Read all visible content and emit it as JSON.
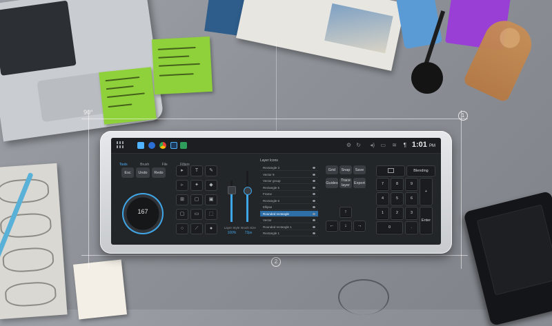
{
  "annotations": {
    "angle_label": "90°",
    "callout_1": "1",
    "callout_2": "2"
  },
  "taskbar": {
    "start_icon": "windows-icon",
    "pinned_icons": [
      "edge-icon",
      "chrome-icon",
      "photoshop-icon",
      "app-icon"
    ],
    "clock": "1:01",
    "clock_suffix": "PM"
  },
  "tabs": [
    {
      "label": "Tools",
      "active": true
    },
    {
      "label": "Brush",
      "active": false
    },
    {
      "label": "File",
      "active": false
    },
    {
      "label": "Filters",
      "active": false
    }
  ],
  "left_keys": {
    "esc": "Esc",
    "undo": "Undo",
    "redo": "Redo"
  },
  "dial": {
    "value": "167"
  },
  "tools": [
    "▸",
    "T",
    "✎",
    "▹",
    "✦",
    "◆",
    "⊞",
    "▢",
    "▣",
    "▢",
    "▭",
    "⬚",
    "○",
    "⟋",
    "●"
  ],
  "sliders": [
    {
      "caption": "Layer Style",
      "value": "100%",
      "level": 0.78
    },
    {
      "caption": "Brush Size",
      "value": "72px",
      "level": 0.62
    }
  ],
  "layers": {
    "title": "Layer Icons",
    "items": [
      {
        "name": "Rectangle 3",
        "selected": false
      },
      {
        "name": "Vector 9",
        "selected": false
      },
      {
        "name": "Vector group",
        "selected": false
      },
      {
        "name": "Rectangle 5",
        "selected": false
      },
      {
        "name": "Frame",
        "selected": false
      },
      {
        "name": "Rectangle 6",
        "selected": false
      },
      {
        "name": "Ellipse",
        "selected": false
      },
      {
        "name": "Rounded rectangle",
        "selected": true
      },
      {
        "name": "Vector",
        "selected": false
      },
      {
        "name": "Rounded rectangle 1",
        "selected": false
      },
      {
        "name": "Rectangle 1",
        "selected": false
      }
    ]
  },
  "action_keys": {
    "grid": "Grid",
    "snap": "Snap",
    "save": "Save",
    "guides": "Guides",
    "trace_layer": "Trace layer",
    "export": "Export"
  },
  "arrow_keys": [
    "↑",
    "←",
    "↓",
    "→"
  ],
  "numpad": {
    "top_icon": "monitor-icon",
    "blending": "Blending",
    "keys": [
      "7",
      "8",
      "9",
      "4",
      "5",
      "6",
      "1",
      "2",
      "3",
      "0",
      "."
    ],
    "plus": "+",
    "enter": "Enter"
  },
  "colors": {
    "accent": "#3fa6e8",
    "selected_row": "#2f6fa8",
    "screen_bg": "#232629",
    "sticky_note": "#8fd13a"
  }
}
